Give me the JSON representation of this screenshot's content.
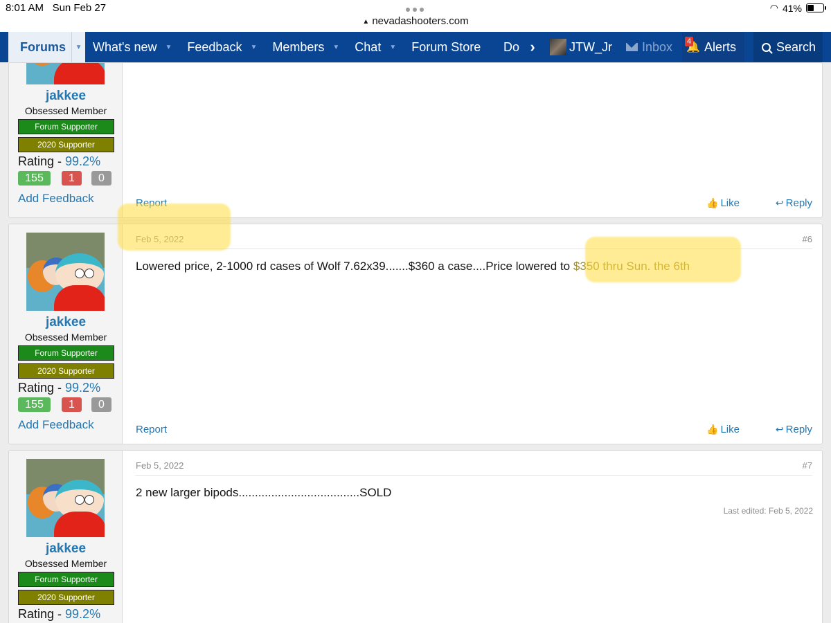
{
  "status": {
    "time": "8:01 AM",
    "date": "Sun Feb 27",
    "url": "nevadashooters.com",
    "battery": "41%",
    "battery_level": 0.41
  },
  "nav": {
    "forums": "Forums",
    "items": [
      "What's new",
      "Feedback",
      "Members",
      "Chat",
      "Forum Store"
    ],
    "more": "Do",
    "user": "JTW_Jr",
    "inbox": "Inbox",
    "alerts": "Alerts",
    "alerts_count": "4",
    "search": "Search"
  },
  "user": {
    "name": "jakkee",
    "title": "Obsessed Member",
    "banner1": "Forum Supporter",
    "banner2": "2020 Supporter",
    "rating_label": "Rating - ",
    "rating_value": "99.2%",
    "fb_positive": "155",
    "fb_negative": "1",
    "fb_neutral": "0",
    "add_feedback": "Add Feedback"
  },
  "actions": {
    "report": "Report",
    "like": "Like",
    "reply": "Reply"
  },
  "posts": [
    {
      "date": "Feb 5, 2022",
      "number": "#6",
      "message_a": "Lowered price, 2-1000 rd cases of Wolf 7.62x39.......$360 a case....Price lowered to ",
      "message_b": "$350 thru Sun. the 6th"
    },
    {
      "date": "Feb 5, 2022",
      "number": "#7",
      "message": "2 new larger bipods.....................................SOLD",
      "edited": "Last edited: Feb 5, 2022"
    }
  ],
  "colors": {
    "nav_bg": "#0a4594",
    "link": "#2577b1",
    "forum_supporter": "#1b8a1b",
    "supporter_2020": "#808000",
    "highlight": "#ffdc3c"
  }
}
